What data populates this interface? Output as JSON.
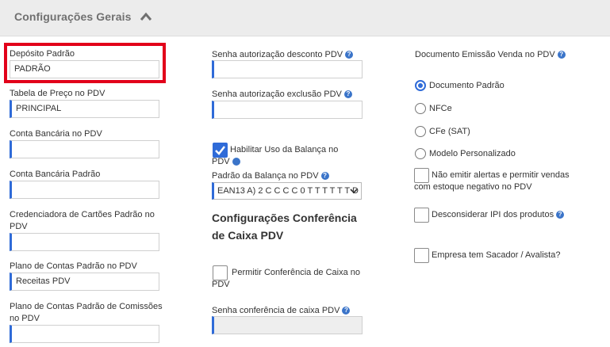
{
  "header": {
    "title": "Configurações Gerais"
  },
  "col1": {
    "deposito": {
      "label": "Depósito Padrão",
      "value": "PADRÃO"
    },
    "tabela": {
      "label": "Tabela de Preço no PDV",
      "value": "PRINCIPAL"
    },
    "conta_pdv": {
      "label": "Conta Bancária no PDV",
      "value": ""
    },
    "conta_padrao": {
      "label": "Conta Bancária Padrão",
      "value": ""
    },
    "credenciadora": {
      "label": "Credenciadora de Cartões Padrão no PDV",
      "value": ""
    },
    "plano_contas": {
      "label": "Plano de Contas Padrão no PDV",
      "value": "Receitas PDV"
    },
    "plano_comissoes": {
      "label": "Plano de Contas Padrão de Comissões no PDV",
      "value": ""
    }
  },
  "col2": {
    "senha_desconto": {
      "label": "Senha autorização desconto PDV",
      "value": ""
    },
    "senha_exclusao": {
      "label": "Senha autorização exclusão PDV",
      "value": ""
    },
    "balanca": {
      "label": "Habilitar Uso da Balança no PDV",
      "checked": true
    },
    "padrao_balanca": {
      "label": "Padrão da Balança no PDV",
      "value": "EAN13 A) 2 C C C C 0 T T T T T T D"
    },
    "secao_conferencia": {
      "title": "Configurações Conferência de Caixa PDV"
    },
    "permitir_conferencia": {
      "label": "Permitir Conferência de Caixa no PDV",
      "checked": false
    },
    "senha_conferencia": {
      "label": "Senha conferência de caixa PDV",
      "value": ""
    }
  },
  "col3": {
    "documento": {
      "label": "Documento Emissão Venda no PDV"
    },
    "options": [
      {
        "label": "Documento Padrão",
        "checked": true
      },
      {
        "label": "NFCe",
        "checked": false
      },
      {
        "label": "CFe (SAT)",
        "checked": false
      },
      {
        "label": "Modelo Personalizado",
        "checked": false
      }
    ],
    "nao_emitir": {
      "label": "Não emitir alertas e permitir vendas com estoque negativo no PDV",
      "checked": false
    },
    "desconsiderar_ipi": {
      "label": "Desconsiderar IPI dos produtos",
      "checked": false
    },
    "sacador": {
      "label": "Empresa tem Sacador / Avalista?",
      "checked": false
    }
  },
  "colors": {
    "accent": "#2f6bd8",
    "highlight": "#e2001a",
    "header_bg": "#ececec"
  }
}
